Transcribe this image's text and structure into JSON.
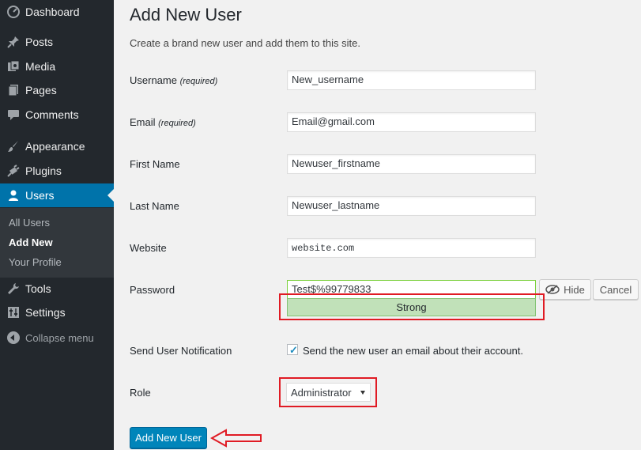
{
  "sidebar": {
    "items": [
      {
        "label": "Dashboard",
        "icon": "dashboard-icon"
      },
      {
        "label": "Posts",
        "icon": "pin-icon"
      },
      {
        "label": "Media",
        "icon": "media-icon"
      },
      {
        "label": "Pages",
        "icon": "pages-icon"
      },
      {
        "label": "Comments",
        "icon": "comment-icon"
      },
      {
        "label": "Appearance",
        "icon": "brush-icon"
      },
      {
        "label": "Plugins",
        "icon": "plugin-icon"
      },
      {
        "label": "Users",
        "icon": "users-icon"
      },
      {
        "label": "Tools",
        "icon": "wrench-icon"
      },
      {
        "label": "Settings",
        "icon": "settings-icon"
      }
    ],
    "submenu": [
      "All Users",
      "Add New",
      "Your Profile"
    ],
    "collapse_label": "Collapse menu"
  },
  "page": {
    "title": "Add New User",
    "description": "Create a brand new user and add them to this site."
  },
  "form": {
    "username": {
      "label": "Username",
      "req": "(required)",
      "value": "New_username"
    },
    "email": {
      "label": "Email",
      "req": "(required)",
      "value": "Email@gmail.com"
    },
    "first_name": {
      "label": "First Name",
      "value": "Newuser_firstname"
    },
    "last_name": {
      "label": "Last Name",
      "value": "Newuser_lastname"
    },
    "website": {
      "label": "Website",
      "value": "website.com"
    },
    "password": {
      "label": "Password",
      "value": "Test$%99779833",
      "strength": "Strong",
      "hide_label": "Hide",
      "cancel_label": "Cancel"
    },
    "notification": {
      "label": "Send User Notification",
      "text": "Send the new user an email about their account.",
      "checked": true
    },
    "role": {
      "label": "Role",
      "value": "Administrator"
    },
    "submit_label": "Add New User"
  },
  "colors": {
    "sidebar_bg": "#23282d",
    "accent": "#0073aa",
    "primary_button": "#0085ba",
    "strength_bg": "#c1e1b9",
    "annotation_red": "#e01b24"
  }
}
